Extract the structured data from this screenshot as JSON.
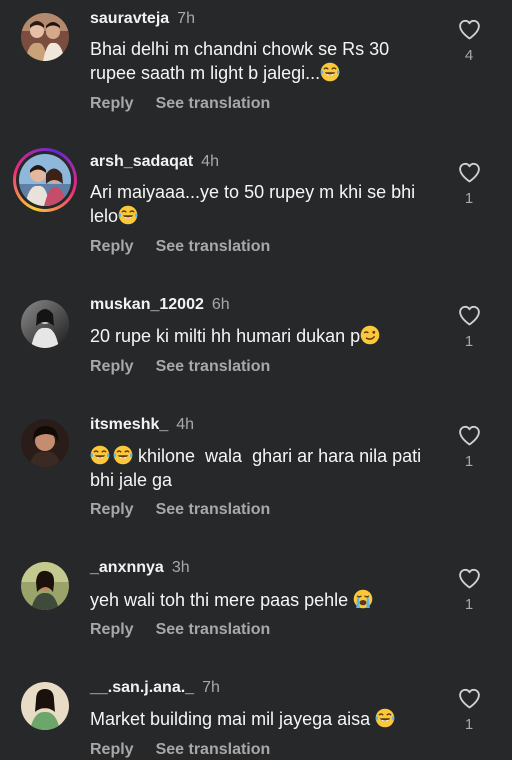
{
  "comments": [
    {
      "username": "sauravteja",
      "time": "7h",
      "text": "Bhai delhi m chandni chowk se Rs 30 rupee saath m light b jalegi...",
      "text_emoji": "laugh-cry",
      "reply": "Reply",
      "see_translation": "See translation",
      "likes": "4",
      "avatar_icon": "profile-photo"
    },
    {
      "username": "arsh_sadaqat",
      "time": "4h",
      "text": "Ari maiyaaa...ye to 50 rupey m khi se bhi lelo",
      "text_emoji": "laugh-cry",
      "reply": "Reply",
      "see_translation": "See translation",
      "likes": "1",
      "avatar_icon": "profile-photo-story-ring"
    },
    {
      "username": "muskan_12002",
      "time": "6h",
      "text": "20 rupe ki milti hh humari dukan p",
      "text_emoji": "wink",
      "reply": "Reply",
      "see_translation": "See translation",
      "likes": "1",
      "avatar_icon": "profile-photo"
    },
    {
      "username": "itsmeshk_",
      "time": "4h",
      "text_prefix_emoji": "laugh-cry x2",
      "text": " khilone  wala  ghari ar hara nila pati bhi jale ga",
      "reply": "Reply",
      "see_translation": "See translation",
      "likes": "1",
      "avatar_icon": "profile-photo"
    },
    {
      "username": "_anxnnya",
      "time": "3h",
      "text": "yeh wali toh thi mere paas pehle ",
      "text_emoji": "loudly-crying",
      "reply": "Reply",
      "see_translation": "See translation",
      "likes": "1",
      "avatar_icon": "profile-photo"
    },
    {
      "username": "__.san.j.ana._",
      "time": "7h",
      "text": "Market building mai mil jayega aisa ",
      "text_emoji": "laugh-cry",
      "reply": "Reply",
      "see_translation": "See translation",
      "likes": "1",
      "avatar_icon": "profile-photo"
    }
  ],
  "colors": {
    "background": "#272829",
    "username": "#f2f2f2",
    "secondary": "#a8a8a8",
    "text": "#f5f5f5"
  }
}
